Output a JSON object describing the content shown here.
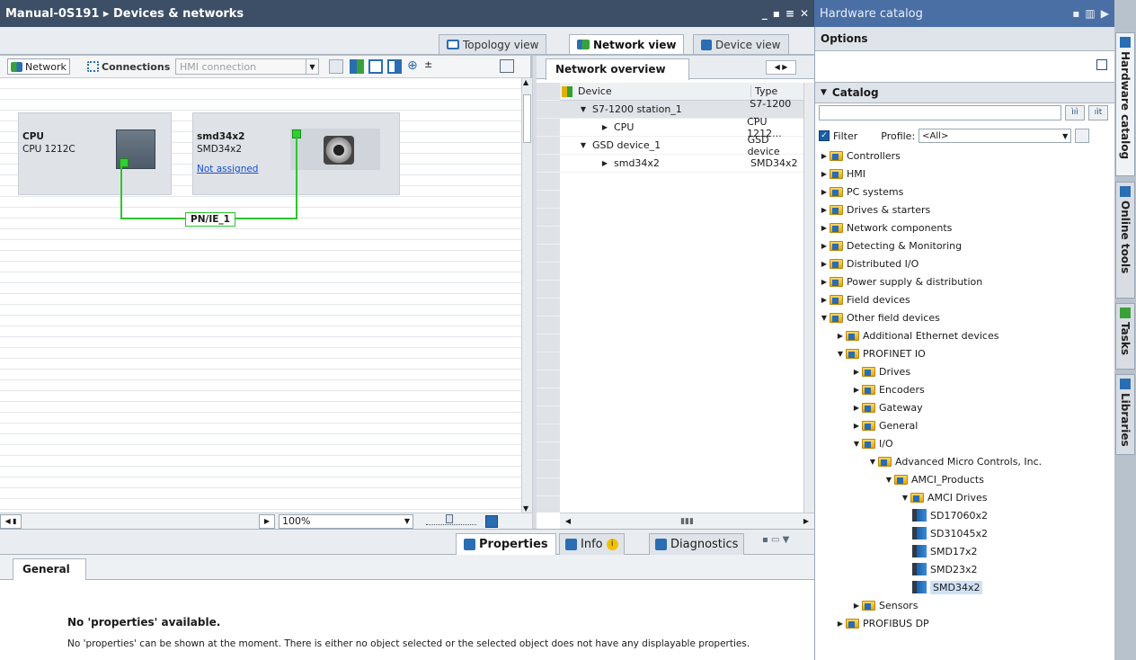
{
  "editor": {
    "title": "Manual-0S191 ▸ Devices & networks",
    "controls": [
      "_",
      "▪",
      "≡",
      "✕"
    ]
  },
  "view_tabs": [
    {
      "label": "Topology view",
      "active": false
    },
    {
      "label": "Network view",
      "active": true
    },
    {
      "label": "Device view",
      "active": false
    }
  ],
  "toolbar": {
    "network_label": "Network",
    "connections_label": "Connections",
    "connection_type": "HMI connection"
  },
  "devices": {
    "cpu": {
      "name": "CPU",
      "type": "CPU 1212C"
    },
    "smd": {
      "name": "smd34x2",
      "type": "SMD34x2",
      "link": "Not assigned"
    }
  },
  "network_label": "PN/IE_1",
  "zoom": "100%",
  "overview": {
    "tab": "Network overview",
    "columns": [
      "Device",
      "Type"
    ],
    "rows": [
      {
        "device": "S7-1200 station_1",
        "type": "S7-1200 ...",
        "expanded": true,
        "indent": 0
      },
      {
        "device": "CPU",
        "type": "CPU 1212...",
        "expanded": false,
        "indent": 1
      },
      {
        "device": "GSD device_1",
        "type": "GSD device",
        "expanded": true,
        "indent": 0
      },
      {
        "device": "smd34x2",
        "type": "SMD34x2",
        "expanded": false,
        "indent": 1
      }
    ]
  },
  "inspector": {
    "tabs": [
      "Properties",
      "Info",
      "Diagnostics"
    ],
    "general_tab": "General",
    "heading": "No 'properties' available.",
    "message": "No 'properties' can be shown at the moment. There is either no object selected or the selected object does not have any displayable properties."
  },
  "catalog_panel": {
    "title": "Hardware catalog",
    "options_label": "Options",
    "catalog_label": "Catalog",
    "search_value": "",
    "filter_label": "Filter",
    "filter_checked": true,
    "profile_label": "Profile:",
    "profile_value": "<All>",
    "tree": [
      {
        "label": "Controllers",
        "level": 0,
        "state": "collapsed",
        "kind": "folder"
      },
      {
        "label": "HMI",
        "level": 0,
        "state": "collapsed",
        "kind": "folder"
      },
      {
        "label": "PC systems",
        "level": 0,
        "state": "collapsed",
        "kind": "folder"
      },
      {
        "label": "Drives & starters",
        "level": 0,
        "state": "collapsed",
        "kind": "folder"
      },
      {
        "label": "Network components",
        "level": 0,
        "state": "collapsed",
        "kind": "folder"
      },
      {
        "label": "Detecting & Monitoring",
        "level": 0,
        "state": "collapsed",
        "kind": "folder"
      },
      {
        "label": "Distributed I/O",
        "level": 0,
        "state": "collapsed",
        "kind": "folder"
      },
      {
        "label": "Power supply & distribution",
        "level": 0,
        "state": "collapsed",
        "kind": "folder"
      },
      {
        "label": "Field devices",
        "level": 0,
        "state": "collapsed",
        "kind": "folder"
      },
      {
        "label": "Other field devices",
        "level": 0,
        "state": "expanded",
        "kind": "folder"
      },
      {
        "label": "Additional Ethernet devices",
        "level": 1,
        "state": "collapsed",
        "kind": "folder"
      },
      {
        "label": "PROFINET IO",
        "level": 1,
        "state": "expanded",
        "kind": "folder"
      },
      {
        "label": "Drives",
        "level": 2,
        "state": "collapsed",
        "kind": "folder"
      },
      {
        "label": "Encoders",
        "level": 2,
        "state": "collapsed",
        "kind": "folder"
      },
      {
        "label": "Gateway",
        "level": 2,
        "state": "collapsed",
        "kind": "folder"
      },
      {
        "label": "General",
        "level": 2,
        "state": "collapsed",
        "kind": "folder"
      },
      {
        "label": "I/O",
        "level": 2,
        "state": "expanded",
        "kind": "folder"
      },
      {
        "label": "Advanced Micro Controls, Inc.",
        "level": 3,
        "state": "expanded",
        "kind": "folder"
      },
      {
        "label": "AMCI_Products",
        "level": 4,
        "state": "expanded",
        "kind": "folder"
      },
      {
        "label": "AMCI Drives",
        "level": 5,
        "state": "expanded",
        "kind": "folder"
      },
      {
        "label": "SD17060x2",
        "level": 6,
        "state": "leaf",
        "kind": "module"
      },
      {
        "label": "SD31045x2",
        "level": 6,
        "state": "leaf",
        "kind": "module"
      },
      {
        "label": "SMD17x2",
        "level": 6,
        "state": "leaf",
        "kind": "module"
      },
      {
        "label": "SMD23x2",
        "level": 6,
        "state": "leaf",
        "kind": "module"
      },
      {
        "label": "SMD34x2",
        "level": 6,
        "state": "leaf",
        "kind": "module",
        "selected": true
      },
      {
        "label": "Sensors",
        "level": 2,
        "state": "collapsed",
        "kind": "folder"
      },
      {
        "label": "PROFIBUS DP",
        "level": 1,
        "state": "collapsed",
        "kind": "folder"
      }
    ]
  },
  "side_tabs": [
    "Hardware catalog",
    "Online tools",
    "Tasks",
    "Libraries"
  ]
}
